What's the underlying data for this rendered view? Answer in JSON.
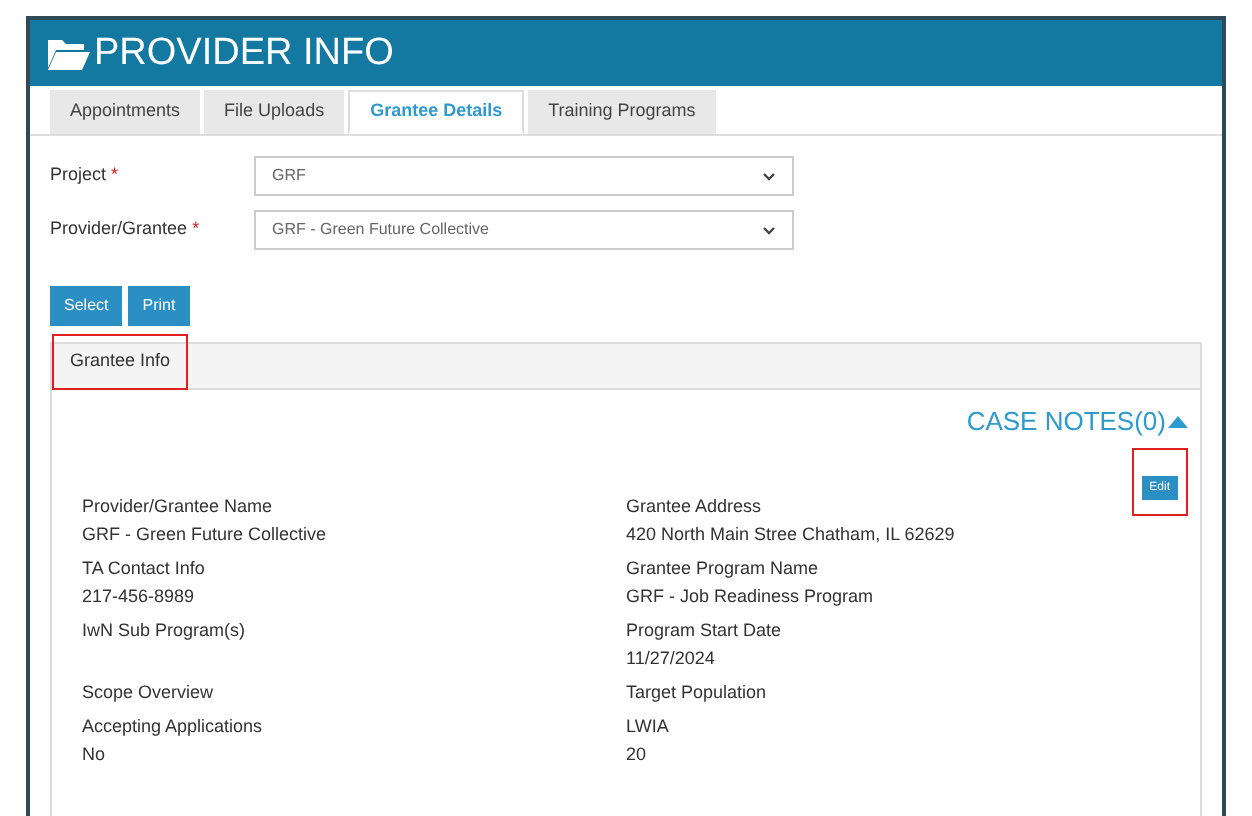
{
  "header": {
    "title": "PROVIDER INFO"
  },
  "tabs": [
    {
      "label": "Appointments",
      "selected": false
    },
    {
      "label": "File Uploads",
      "selected": false
    },
    {
      "label": "Grantee Details",
      "selected": true
    },
    {
      "label": "Training Programs",
      "selected": false
    }
  ],
  "form": [
    {
      "label": "Project",
      "required_mark": "*",
      "value": "GRF"
    },
    {
      "label": "Provider/Grantee",
      "required_mark": "*",
      "value": "GRF - Green Future Collective"
    }
  ],
  "buttons": [
    "Select",
    "Print"
  ],
  "panel": {
    "title": "Grantee Info",
    "title_highlighted": true,
    "case_notes": "CASE NOTES(0)",
    "edit_button": "Edit",
    "edit_highlighted": true,
    "rows": [
      [
        {
          "label": "Provider/Grantee Name",
          "value": "GRF - Green Future Collective"
        },
        {
          "label": "Grantee Address",
          "value": "420 North Main Stree Chatham, IL 62629"
        }
      ],
      [
        {
          "label": "TA Contact Info",
          "value": "217-456-8989"
        },
        {
          "label": "Grantee Program Name",
          "value": "GRF - Job Readiness Program"
        }
      ],
      [
        {
          "label": "IwN Sub Program(s)"
        },
        {
          "label": "Program Start Date",
          "value": "11/27/2024"
        }
      ],
      [
        {
          "label": "Scope Overview"
        },
        {
          "label": "Target Population"
        }
      ],
      [
        {
          "label": "Accepting Applications",
          "value": "No"
        },
        {
          "label": "LWIA",
          "value": "20"
        }
      ]
    ]
  }
}
